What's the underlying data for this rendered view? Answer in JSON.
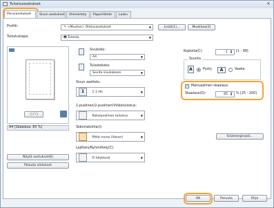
{
  "window": {
    "title": "Tulostusasetukset"
  },
  "tabs": [
    {
      "label": "Perusasetukset"
    },
    {
      "label": "Sivun asetukset"
    },
    {
      "label": "Viimeistely"
    },
    {
      "label": "Paperilähde"
    },
    {
      "label": "Laatu"
    }
  ],
  "profile": {
    "label": "Profiili:",
    "value": "<Muutos> Oletusasetukset",
    "add_label": "Lisää(1)...",
    "edit_label": "Muokkaa(2)"
  },
  "output_method": {
    "label": "Tulostustapa:",
    "value": "Tulosta"
  },
  "preview": {
    "caption": "A4 [Skaalaus: 85 %]"
  },
  "buttons": {
    "view_settings": "Näytä asetukset(6)",
    "restore_defaults": "Palauta oletukset",
    "ok": "OK",
    "cancel": "Peruuta",
    "help": "Ohje",
    "stamp": "Sisämerginaali..."
  },
  "page_size": {
    "label": "Sivukoko:",
    "value": "A4"
  },
  "output_size": {
    "label": "Tulostekoko:",
    "value": "Sovita sivukokoon"
  },
  "copies": {
    "label": "Kopioita(C):",
    "value": "1",
    "range": "[1 - 99]"
  },
  "orientation": {
    "label": "Suunta",
    "portrait": "Pysty",
    "landscape": "Vaaka"
  },
  "manual_scaling": {
    "label": "Manuaalinen skaalaus",
    "checked": true
  },
  "scaling": {
    "label": "Skaalaus(G):",
    "value": "85",
    "range": "% [25 - 200]"
  },
  "page_layout": {
    "label": "Sivun asettelu:",
    "value": "1 1 ille",
    "number": "1"
  },
  "duplex": {
    "label": "1-puolinen/2-puolinen/Vihkotulostus:",
    "value": "Kaksipuolinen tulostus"
  },
  "binding": {
    "label": "Sidontakohta(I):",
    "value": "Pitkä reuna (Vasen)"
  },
  "finishing": {
    "label": "Lajittelu/Ryhmittely(C):",
    "value": "Ei käytössä"
  }
}
